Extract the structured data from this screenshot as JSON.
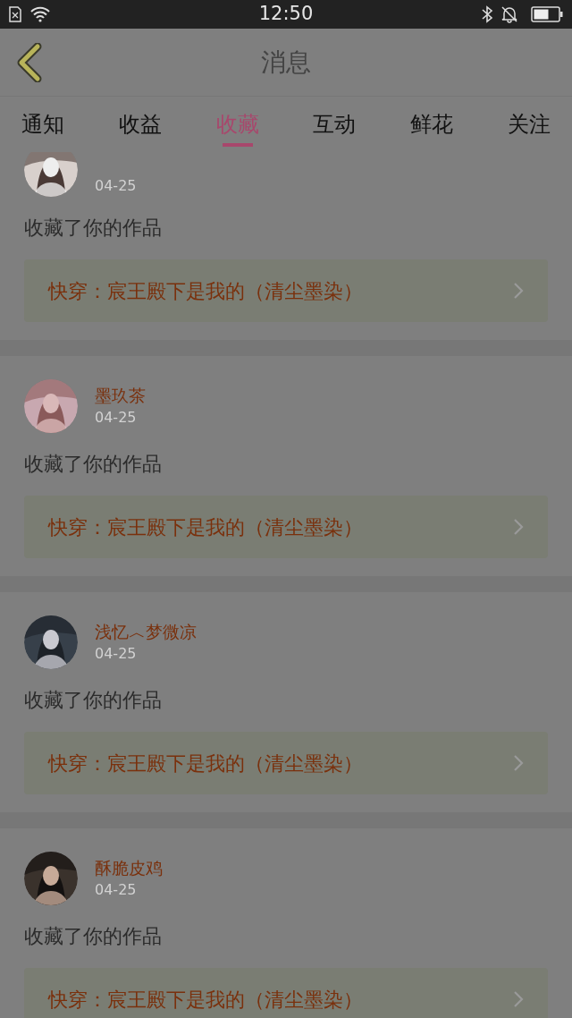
{
  "status_bar": {
    "time": "12:50"
  },
  "header": {
    "title": "消息"
  },
  "tabs": [
    {
      "label": "通知",
      "selected": false
    },
    {
      "label": "收益",
      "selected": false
    },
    {
      "label": "收藏",
      "selected": true
    },
    {
      "label": "互动",
      "selected": false
    },
    {
      "label": "鲜花",
      "selected": false
    },
    {
      "label": "关注",
      "selected": false
    }
  ],
  "messages": [
    {
      "date": "04-25",
      "text": "收藏了你的作品",
      "work": "快穿：宸王殿下是我的（清尘墨染）"
    },
    {
      "name": "墨玖茶",
      "date": "04-25",
      "text": "收藏了你的作品",
      "work": "快穿：宸王殿下是我的（清尘墨染）"
    },
    {
      "name": "浅忆︿梦微凉",
      "date": "04-25",
      "text": "收藏了你的作品",
      "work": "快穿：宸王殿下是我的（清尘墨染）"
    },
    {
      "name": "酥脆皮鸡",
      "date": "04-25",
      "text": "收藏了你的作品",
      "work": "快穿：宸王殿下是我的（清尘墨染）"
    }
  ]
}
